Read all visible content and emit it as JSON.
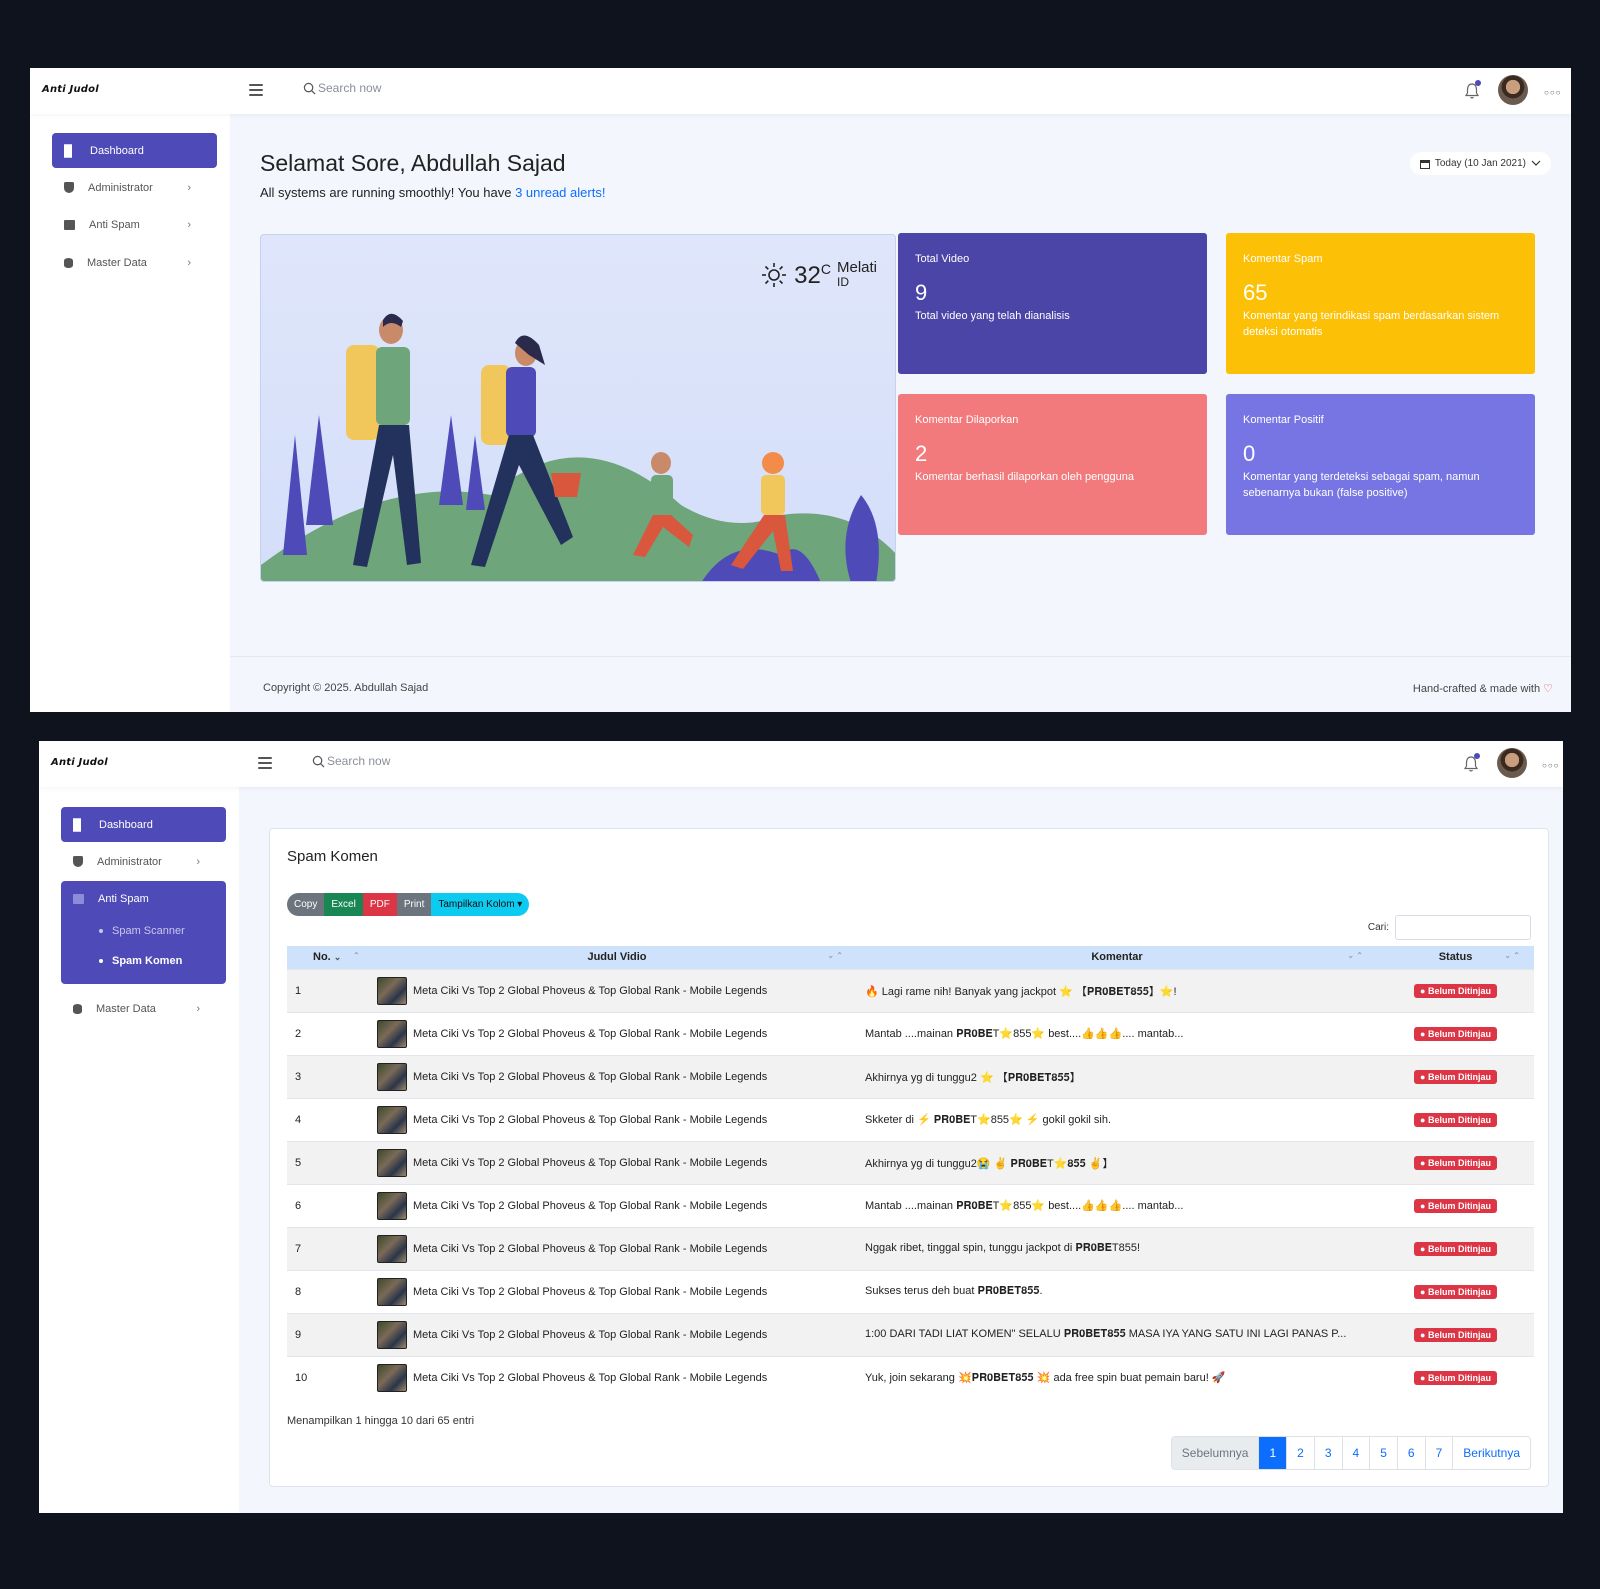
{
  "brand": "Anti Judol",
  "search_placeholder": "Search now",
  "sidebar": {
    "dashboard": "Dashboard",
    "administrator": "Administrator",
    "anti_spam": "Anti Spam",
    "master_data": "Master Data",
    "spam_scanner": "Spam Scanner",
    "spam_komen": "Spam Komen"
  },
  "dashboard": {
    "greeting": "Selamat Sore, Abdullah Sajad",
    "subtitle_prefix": "All systems are running smoothly! You have ",
    "alerts_link": "3 unread alerts!",
    "date_picker": "Today (10 Jan 2021)",
    "weather": {
      "temp": "32",
      "unit": "C",
      "location": "Melati",
      "country": "ID"
    },
    "cards": [
      {
        "title": "Total Video",
        "value": "9",
        "desc": "Total video yang telah dianalisis",
        "color": "#4a45a6"
      },
      {
        "title": "Komentar Spam",
        "value": "65",
        "desc": "Komentar yang terindikasi spam berdasarkan sistem deteksi otomatis",
        "color": "#fcc006"
      },
      {
        "title": "Komentar Dilaporkan",
        "value": "2",
        "desc": "Komentar berhasil dilaporkan oleh pengguna",
        "color": "#f27a7d"
      },
      {
        "title": "Komentar Positif",
        "value": "0",
        "desc": "Komentar yang terdeteksi sebagai spam, namun sebenarnya bukan (false positive)",
        "color": "#7775e3"
      }
    ]
  },
  "footer": {
    "copyright": "Copyright © 2025. Abdullah Sajad",
    "made_with": "Hand-crafted & made with"
  },
  "spam_page": {
    "title": "Spam Komen",
    "buttons": [
      {
        "label": "Copy",
        "color": "#6c757d"
      },
      {
        "label": "Excel",
        "color": "#198754"
      },
      {
        "label": "PDF",
        "color": "#dc3545"
      },
      {
        "label": "Print",
        "color": "#6c757d"
      },
      {
        "label": "Tampilkan Kolom ▾",
        "color": "#0dcaf0"
      }
    ],
    "search_label": "Cari:",
    "columns": [
      "No.",
      "Judul Vidio",
      "Komentar",
      "Status"
    ],
    "rows": [
      {
        "no": "1",
        "judul": "Meta Ciki Vs Top 2 Global Phoveus & Top Global Rank - Mobile Legends",
        "komentar": "🔥 Lagi rame nih! Banyak yang jackpot ⭐ 【𝐏𝐑𝟎𝐁𝐄𝐓𝟖𝟓𝟓】⭐!",
        "status": "Belum Ditinjau"
      },
      {
        "no": "2",
        "judul": "Meta Ciki Vs Top 2 Global Phoveus & Top Global Rank - Mobile Legends",
        "komentar": "Mantab ....mainan 𝐏𝐑𝟎𝐁𝐄T⭐855⭐ best....👍👍👍.... mantab...",
        "status": "Belum Ditinjau"
      },
      {
        "no": "3",
        "judul": "Meta Ciki Vs Top 2 Global Phoveus & Top Global Rank - Mobile Legends",
        "komentar": "Akhirnya yg di tunggu2 ⭐ 【𝐏𝐑𝟎𝐁𝐄𝐓𝟖𝟓𝟓】",
        "status": "Belum Ditinjau"
      },
      {
        "no": "4",
        "judul": "Meta Ciki Vs Top 2 Global Phoveus & Top Global Rank - Mobile Legends",
        "komentar": "Skketer di ⚡ 𝐏𝐑𝟎𝐁𝐄T⭐855⭐ ⚡ gokil gokil sih.",
        "status": "Belum Ditinjau"
      },
      {
        "no": "5",
        "judul": "Meta Ciki Vs Top 2 Global Phoveus & Top Global Rank - Mobile Legends",
        "komentar": "Akhirnya yg di tunggu2😭 ✌ 𝐏𝐑𝟎𝐁𝐄T⭐𝟖𝟓𝟓 ✌】",
        "status": "Belum Ditinjau"
      },
      {
        "no": "6",
        "judul": "Meta Ciki Vs Top 2 Global Phoveus & Top Global Rank - Mobile Legends",
        "komentar": "Mantab ....mainan 𝐏𝐑𝟎𝐁𝐄T⭐855⭐ best....👍👍👍.... mantab...",
        "status": "Belum Ditinjau"
      },
      {
        "no": "7",
        "judul": "Meta Ciki Vs Top 2 Global Phoveus & Top Global Rank - Mobile Legends",
        "komentar": "Nggak ribet, tinggal spin, tunggu jackpot di 𝐏𝐑𝟎𝐁𝐄T855!",
        "status": "Belum Ditinjau"
      },
      {
        "no": "8",
        "judul": "Meta Ciki Vs Top 2 Global Phoveus & Top Global Rank - Mobile Legends",
        "komentar": "Sukses terus deh buat 𝐏𝐑𝟎𝐁𝐄𝐓𝟖𝟓𝟓.",
        "status": "Belum Ditinjau"
      },
      {
        "no": "9",
        "judul": "Meta Ciki Vs Top 2 Global Phoveus & Top Global Rank - Mobile Legends",
        "komentar": "1:00 DARI TADI LIAT KOMEN\" SELALU 𝐏𝐑𝟎𝐁𝐄𝐓𝟖𝟓𝟓 MASA IYA YANG SATU INI LAGI PANAS P...",
        "status": "Belum Ditinjau"
      },
      {
        "no": "10",
        "judul": "Meta Ciki Vs Top 2 Global Phoveus & Top Global Rank - Mobile Legends",
        "komentar": "Yuk, join sekarang 💥𝐏𝐑𝟎𝐁𝐄𝐓𝟖𝟓𝟓 💥 ada free spin buat pemain baru! 🚀",
        "status": "Belum Ditinjau"
      }
    ],
    "info": "Menampilkan 1 hingga 10 dari 65 entri",
    "pagination": [
      "Sebelumnya",
      "1",
      "2",
      "3",
      "4",
      "5",
      "6",
      "7",
      "Berikutnya"
    ],
    "current_page": "1"
  }
}
